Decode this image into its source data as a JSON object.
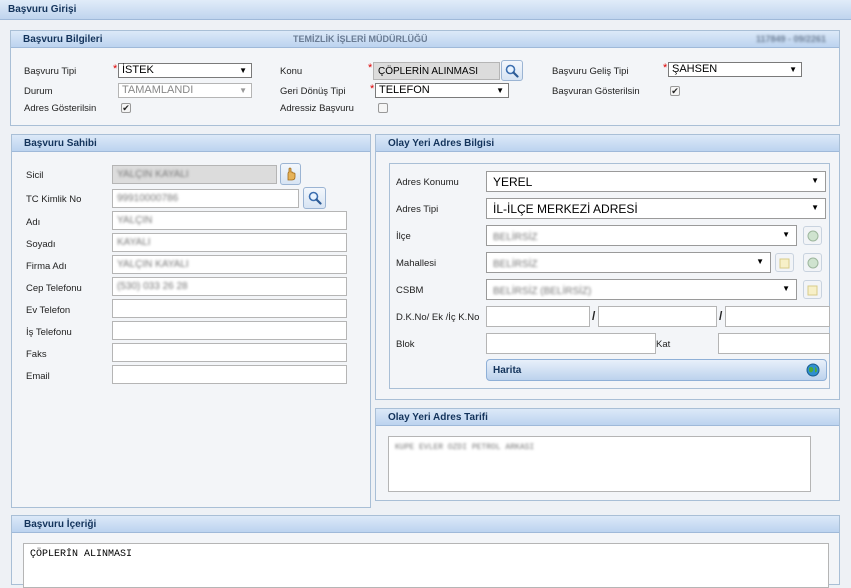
{
  "window": {
    "title": "Başvuru Girişi"
  },
  "basvuru_bilgileri": {
    "title": "Başvuru Bilgileri",
    "department": "TEMİZLİK İŞLERİ MÜDÜRLÜĞÜ",
    "reference": "117849 - 09/2261",
    "basvuru_tipi_label": "Başvuru Tipi",
    "basvuru_tipi_value": "İSTEK",
    "konu_label": "Konu",
    "konu_value": "ÇÖPLERİN ALINMASI",
    "gelis_tipi_label": "Başvuru Geliş Tipi",
    "gelis_tipi_value": "ŞAHSEN",
    "durum_label": "Durum",
    "durum_value": "TAMAMLANDI",
    "geri_donus_label": "Geri Dönüş Tipi",
    "geri_donus_value": "TELEFON",
    "basvuran_gosterilsin_label": "Başvuran Gösterilsin",
    "adres_gosterilsin_label": "Adres Gösterilsin",
    "adressiz_label": "Adressiz Başvuru"
  },
  "basvuru_sahibi": {
    "title": "Başvuru Sahibi",
    "sicil_label": "Sicil",
    "sicil_value": "YALÇIN KAYALI",
    "tc_label": "TC Kimlik No",
    "tc_value": "99910000786",
    "adi_label": "Adı",
    "adi_value": "YALÇIN",
    "soyadi_label": "Soyadı",
    "soyadi_value": "KAYALI",
    "firma_label": "Firma Adı",
    "firma_value": "YALÇIN KAYALI",
    "cep_label": "Cep Telefonu",
    "cep_value": "(530) 033 26 28",
    "ev_label": "Ev Telefon",
    "ev_value": "",
    "is_label": "İş Telefonu",
    "is_value": "",
    "faks_label": "Faks",
    "faks_value": "",
    "email_label": "Email",
    "email_value": ""
  },
  "olay_yeri": {
    "title": "Olay Yeri Adres Bilgisi",
    "adres_konumu_label": "Adres Konumu",
    "adres_konumu_value": "YEREL",
    "adres_tipi_label": "Adres Tipi",
    "adres_tipi_value": "İL-İLÇE MERKEZİ ADRESİ",
    "ilce_label": "İlçe",
    "ilce_value": "BELİRSİZ",
    "mahalle_label": "Mahallesi",
    "mahalle_value": "BELİRSİZ",
    "csbm_label": "CSBM",
    "csbm_value": "BELİRSİZ (BELİRSİZ)",
    "dk_label": "D.K.No/ Ek /İç K.No",
    "blok_label": "Blok",
    "kat_label": "Kat",
    "harita_label": "Harita"
  },
  "adres_tarifi": {
    "title": "Olay Yeri Adres Tarifi",
    "text": "KÜPE EVLER ÖZDI PETROL ARKASI"
  },
  "icerik": {
    "title": "Başvuru İçeriği",
    "text": "ÇÖPLERİN ALINMASI"
  }
}
